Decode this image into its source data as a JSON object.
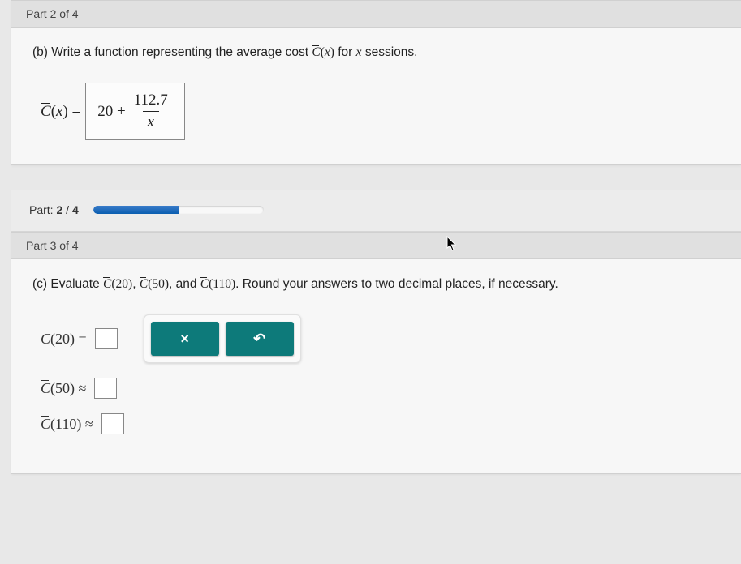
{
  "part2": {
    "header": "Part 2 of 4",
    "prompt_prefix": "(b) Write a function representing the average cost ",
    "prompt_func": "C",
    "prompt_arg_open": "(",
    "prompt_arg_var": "x",
    "prompt_arg_close": ")",
    "prompt_suffix": " for ",
    "prompt_var2": "x",
    "prompt_end": " sessions.",
    "eq_lhs_c": "C",
    "eq_lhs_paren_open": "(",
    "eq_lhs_var": "x",
    "eq_lhs_paren_close": ")",
    "eq_equals": " = ",
    "answer_const": "20 + ",
    "answer_num": "112.7",
    "answer_den": "x"
  },
  "progress": {
    "label_prefix": "Part: ",
    "current": "2",
    "sep": " / ",
    "total": "4",
    "percent": 50
  },
  "part3": {
    "header": "Part 3 of 4",
    "prompt_prefix": "(c) Evaluate ",
    "fn_c": "C",
    "arg20": "(20)",
    "comma1": ", ",
    "arg50": "(50)",
    "comma2": ", and ",
    "arg110": "(110)",
    "prompt_suffix": ". Round your answers to two decimal places, if necessary.",
    "line1_lhs": "(20) = ",
    "line2_lhs": "(50) ≈ ",
    "line3_lhs": "(110) ≈ "
  },
  "buttons": {
    "clear": "×",
    "reset": "↶"
  }
}
